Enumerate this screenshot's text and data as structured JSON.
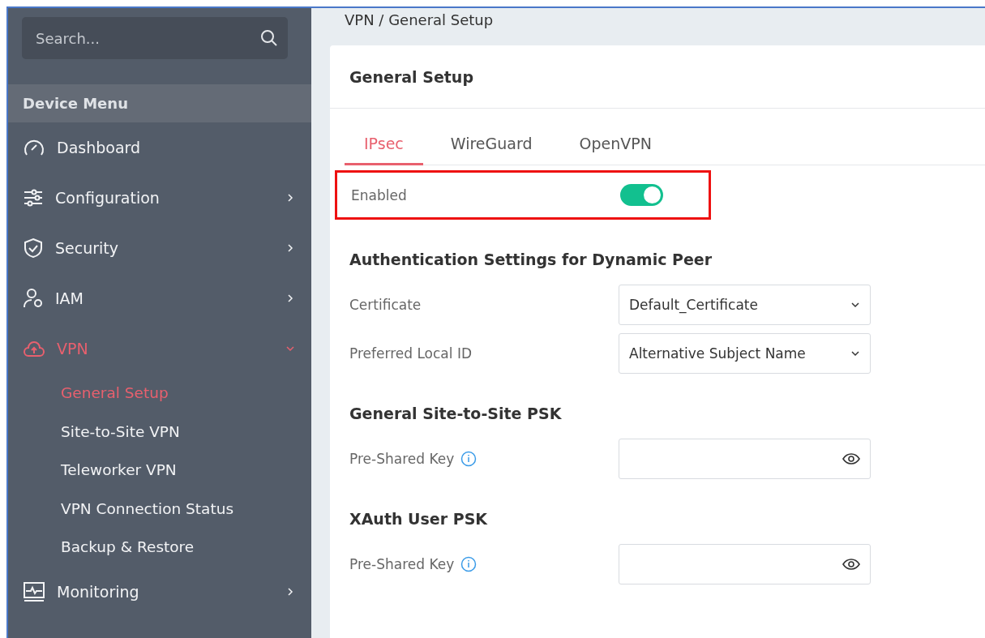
{
  "sidebar": {
    "search": {
      "placeholder": "Search..."
    },
    "heading": "Device Menu",
    "items": [
      {
        "label": "Dashboard",
        "selected": false
      },
      {
        "label": "Configuration",
        "selected": false,
        "expanded": false
      },
      {
        "label": "Security",
        "selected": false,
        "expanded": false
      },
      {
        "label": "IAM",
        "selected": false,
        "expanded": false
      },
      {
        "label": "VPN",
        "selected": true,
        "expanded": true,
        "children": [
          {
            "label": "General Setup",
            "selected": true
          },
          {
            "label": "Site-to-Site VPN",
            "selected": false
          },
          {
            "label": "Teleworker VPN",
            "selected": false
          },
          {
            "label": "VPN Connection Status",
            "selected": false
          },
          {
            "label": "Backup & Restore",
            "selected": false
          }
        ]
      },
      {
        "label": "Monitoring",
        "selected": false,
        "expanded": false
      }
    ]
  },
  "breadcrumb": "VPN / General Setup",
  "card": {
    "title": "General Setup",
    "tabs": [
      {
        "label": "IPsec",
        "selected": true
      },
      {
        "label": "WireGuard",
        "selected": false
      },
      {
        "label": "OpenVPN",
        "selected": false
      }
    ],
    "enabled": {
      "label": "Enabled",
      "on": true,
      "highlighted": true
    },
    "sections": [
      {
        "title": "Authentication Settings for Dynamic Peer",
        "fields": [
          {
            "kind": "select",
            "label": "Certificate",
            "value": "Default_Certificate"
          },
          {
            "kind": "select",
            "label": "Preferred Local ID",
            "value": "Alternative Subject Name"
          }
        ]
      },
      {
        "title": "General Site-to-Site PSK",
        "fields": [
          {
            "kind": "password",
            "label": "Pre-Shared Key",
            "info": true
          }
        ]
      },
      {
        "title": "XAuth User PSK",
        "fields": [
          {
            "kind": "password",
            "label": "Pre-Shared Key",
            "info": true
          }
        ]
      }
    ]
  }
}
